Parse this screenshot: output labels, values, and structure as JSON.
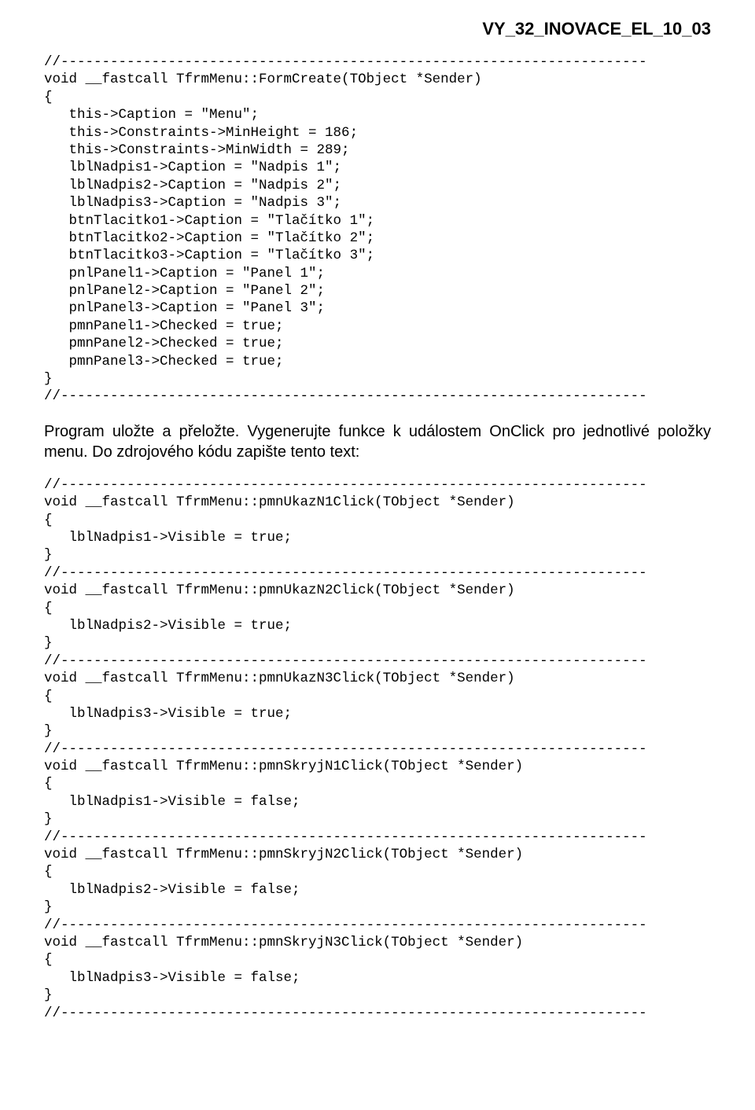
{
  "header": {
    "doc_id": "VY_32_INOVACE_EL_10_03"
  },
  "code1": "void __fastcall TfrmMenu::FormCreate(TObject *Sender)\n{\n   this->Caption = \"Menu\";\n   this->Constraints->MinHeight = 186;\n   this->Constraints->MinWidth = 289;\n   lblNadpis1->Caption = \"Nadpis 1\";\n   lblNadpis2->Caption = \"Nadpis 2\";\n   lblNadpis3->Caption = \"Nadpis 3\";\n   btnTlacitko1->Caption = \"Tlačítko 1\";\n   btnTlacitko2->Caption = \"Tlačítko 2\";\n   btnTlacitko3->Caption = \"Tlačítko 3\";\n   pnlPanel1->Caption = \"Panel 1\";\n   pnlPanel2->Caption = \"Panel 2\";\n   pnlPanel3->Caption = \"Panel 3\";\n   pmnPanel1->Checked = true;\n   pmnPanel2->Checked = true;\n   pmnPanel3->Checked = true;\n}",
  "paragraph": "Program uložte a přeložte. Vygenerujte funkce k událostem OnClick pro jednotlivé položky menu. Do zdrojového kódu zapište tento text:",
  "code2": "void __fastcall TfrmMenu::pmnUkazN1Click(TObject *Sender)\n{\n   lblNadpis1->Visible = true;\n}",
  "code3": "void __fastcall TfrmMenu::pmnUkazN2Click(TObject *Sender)\n{\n   lblNadpis2->Visible = true;\n}",
  "code4": "void __fastcall TfrmMenu::pmnUkazN3Click(TObject *Sender)\n{\n   lblNadpis3->Visible = true;\n}",
  "code5": "void __fastcall TfrmMenu::pmnSkryjN1Click(TObject *Sender)\n{\n   lblNadpis1->Visible = false;\n}",
  "code6": "void __fastcall TfrmMenu::pmnSkryjN2Click(TObject *Sender)\n{\n   lblNadpis2->Visible = false;\n}",
  "code7": "void __fastcall TfrmMenu::pmnSkryjN3Click(TObject *Sender)\n{\n   lblNadpis3->Visible = false;\n}",
  "rule": "//-----------------------------------------------------------------------"
}
